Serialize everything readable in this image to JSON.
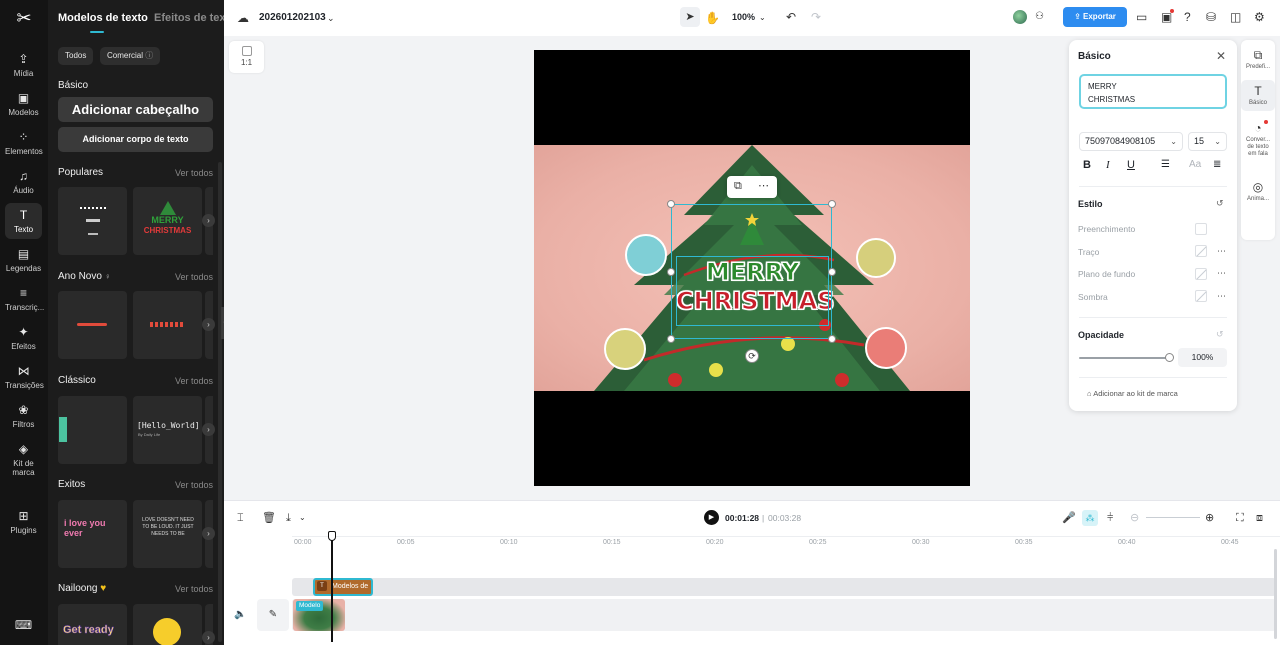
{
  "rail": {
    "items": [
      {
        "label": "Mídia",
        "icon": "⇪"
      },
      {
        "label": "Modelos",
        "icon": "▣"
      },
      {
        "label": "Elementos",
        "icon": "⁘"
      },
      {
        "label": "Áudio",
        "icon": "♫"
      },
      {
        "label": "Texto",
        "icon": "T"
      },
      {
        "label": "Legendas",
        "icon": "▤"
      },
      {
        "label": "Transcriç...",
        "icon": "≡"
      },
      {
        "label": "Efeitos",
        "icon": "✦"
      },
      {
        "label": "Transições",
        "icon": "⋈"
      },
      {
        "label": "Filtros",
        "icon": "❀"
      },
      {
        "label": "Kit de marca",
        "icon": "◈"
      },
      {
        "label": "Plugins",
        "icon": "⊞"
      }
    ],
    "bottom_icon": "⌨"
  },
  "panel": {
    "tabs": [
      "Modelos de texto",
      "Efeitos de texto"
    ],
    "chips": [
      "Todos",
      "Comercial"
    ],
    "basic_title": "Básico",
    "add_heading": "Adicionar cabeçalho",
    "add_body": "Adicionar corpo de texto",
    "see_all": "Ver todos",
    "sections": [
      {
        "title": "Populares"
      },
      {
        "title": "Ano Novo"
      },
      {
        "title": "Clássico"
      },
      {
        "title": "Exitos"
      },
      {
        "title": "Nailoong"
      }
    ],
    "thumbs": {
      "pop2_line1": "MERRY",
      "pop2_line2": "CHRISTMAS",
      "classic2_line1": "[Hello_World]",
      "classic2_line2": "By Daily Life",
      "hit1": "i love you ever",
      "hit2": "LOVE DOESN'T NEED TO BE LOUD. IT JUST NEEDS TO BE",
      "nailoong1": "Get ready"
    }
  },
  "topbar": {
    "project_name": "202601202103",
    "zoom": "100%",
    "export_label": "Exportar"
  },
  "canvas": {
    "ratio_label": "1:1",
    "text_line1": "MERRY",
    "text_line2": "CHRISTMAS"
  },
  "props": {
    "title": "Básico",
    "text_value": "MERRY\nCHRISTMAS",
    "font": "75097084908105",
    "font_size": "15",
    "style_title": "Estilo",
    "rows": [
      "Preenchimento",
      "Traço",
      "Plano de fundo",
      "Sombra"
    ],
    "opacity_title": "Opacidade",
    "opacity_value": "100%",
    "opacity_level": 1.0,
    "brand_kit": "Adicionar ao kit de marca"
  },
  "right_rail": {
    "items": [
      {
        "label": "Predefi...",
        "icon": "⧉"
      },
      {
        "label": "Básico",
        "icon": "T"
      },
      {
        "label": "Conver... de texto em fala",
        "icon": "◔"
      },
      {
        "label": "Anima...",
        "icon": "◎"
      }
    ]
  },
  "timeline": {
    "current_time": "00:01:28",
    "total_time": "00:03:28",
    "ticks": [
      "00:00",
      "00:05",
      "00:10",
      "00:15",
      "00:20",
      "00:25",
      "00:30",
      "00:35",
      "00:40",
      "00:45"
    ],
    "text_clip_label": "Modelos de",
    "video_clip_label": "Modelo"
  },
  "colors": {
    "accent": "#2fb9d1",
    "export": "#2d8cf0",
    "panel_bg": "#1c1c1c",
    "rail_bg": "#141414"
  }
}
